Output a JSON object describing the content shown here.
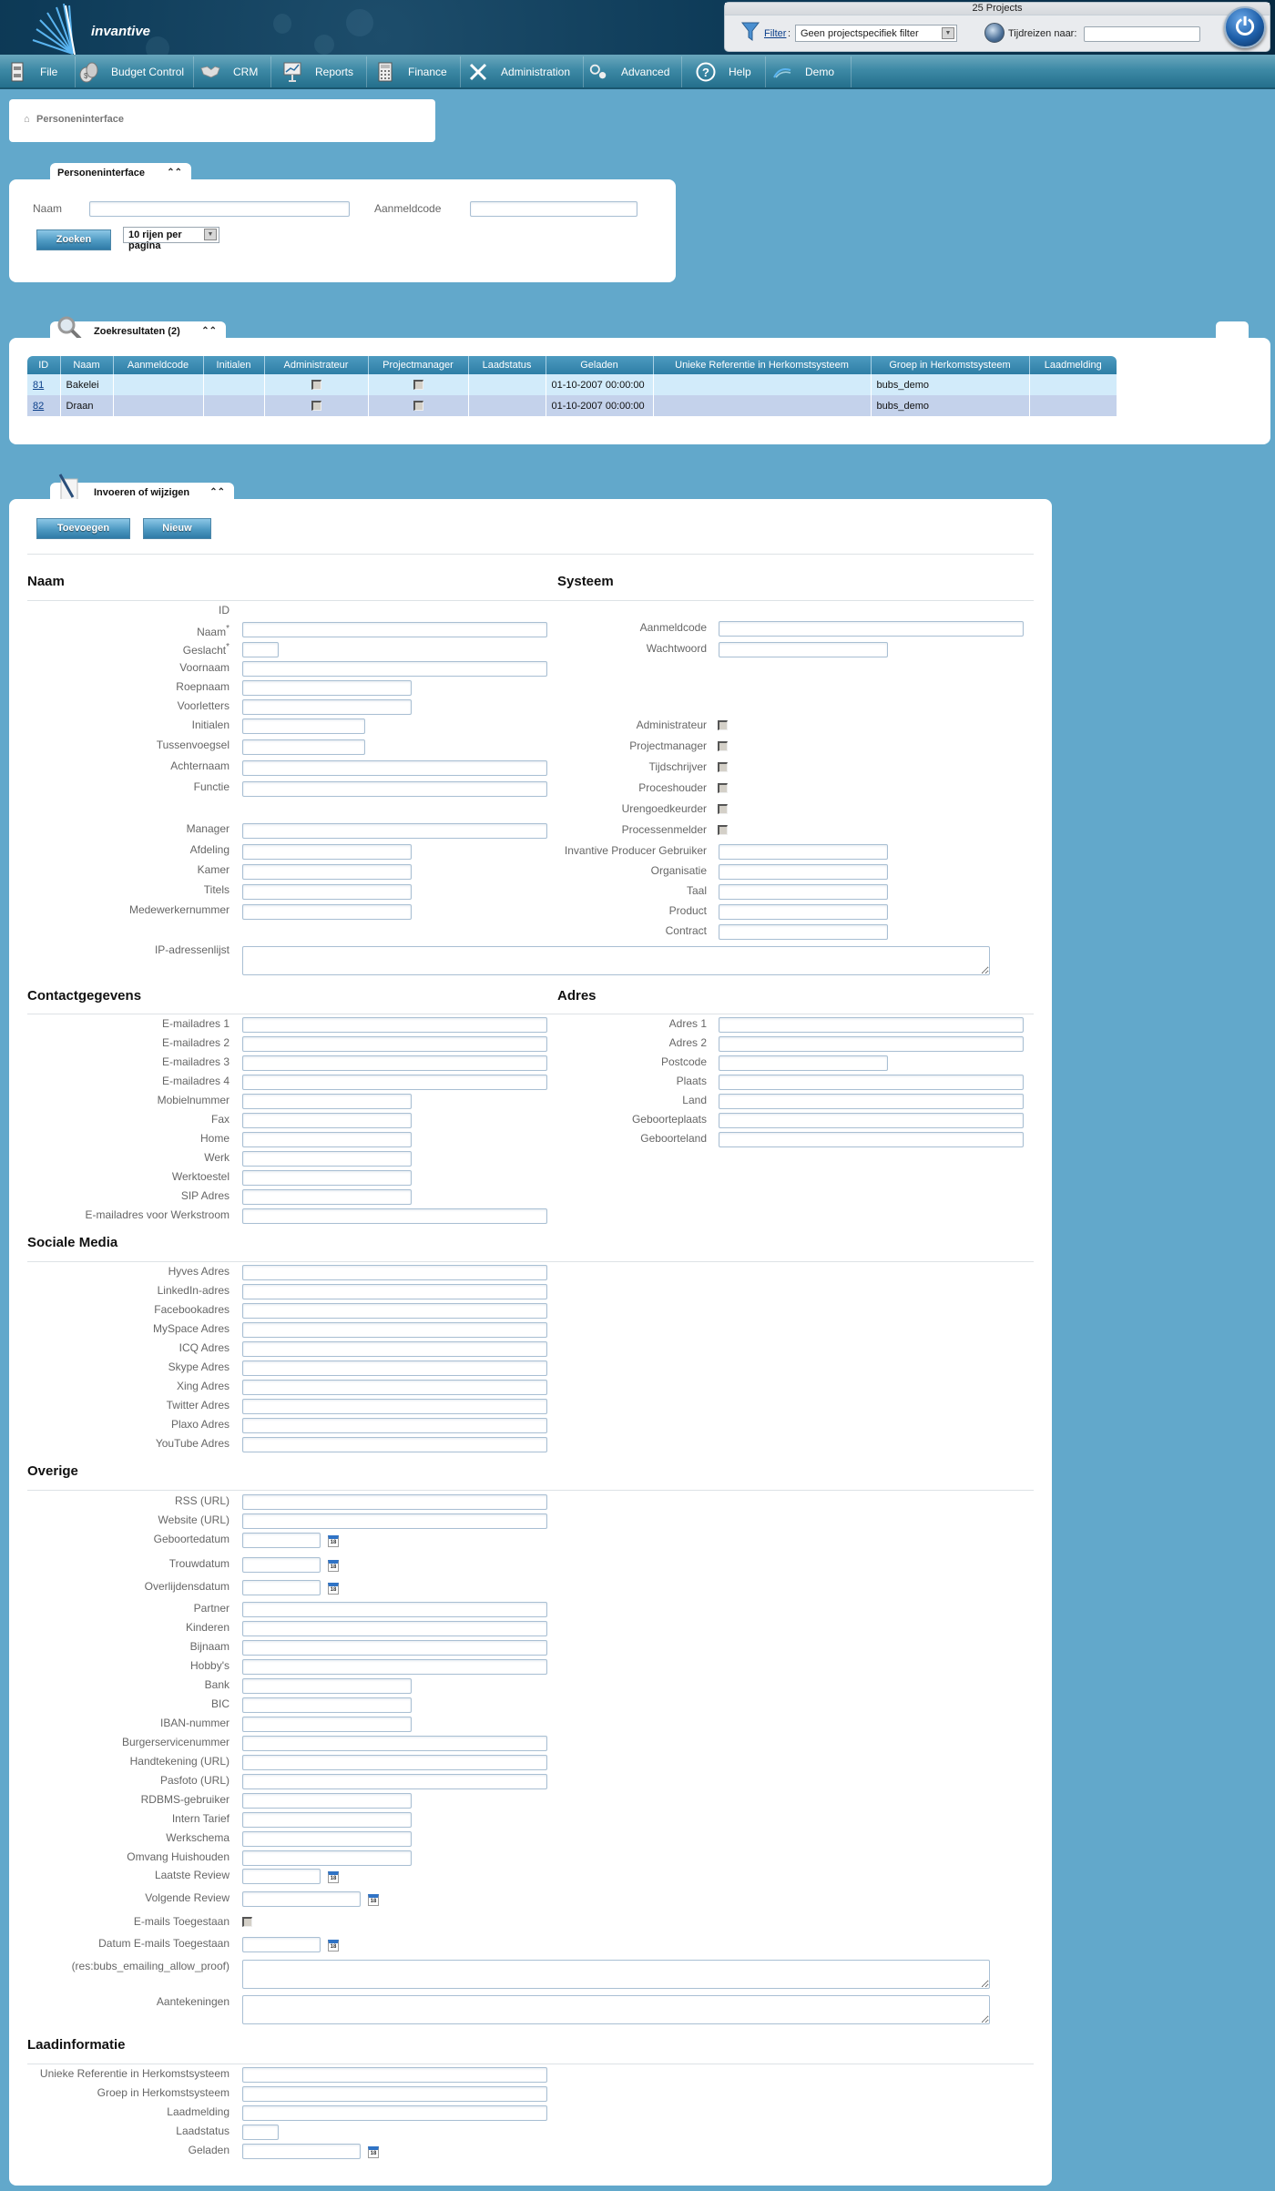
{
  "header": {
    "brand": "invantive",
    "projects_title": "25 Projects",
    "filter_link": "Filter",
    "filter_colon": ":",
    "filter_value": "Geen projectspecifiek filter",
    "time_travel_label": "Tijdreizen naar:",
    "time_travel_value": ""
  },
  "menu": [
    {
      "label": "File",
      "icon": "file-cabinet-icon"
    },
    {
      "label": "Budget Control",
      "icon": "money-bag-icon"
    },
    {
      "label": "CRM",
      "icon": "handshake-icon"
    },
    {
      "label": "Reports",
      "icon": "presentation-board-icon"
    },
    {
      "label": "Finance",
      "icon": "calculator-icon"
    },
    {
      "label": "Administration",
      "icon": "tools-icon"
    },
    {
      "label": "Advanced",
      "icon": "gears-icon"
    },
    {
      "label": "Help",
      "icon": "help-icon"
    },
    {
      "label": "Demo",
      "icon": "demo-logo-icon"
    }
  ],
  "breadcrumb": {
    "label": "Personeninterface"
  },
  "search_panel": {
    "tab_label": "Personeninterface",
    "naam_label": "Naam",
    "naam_value": "",
    "aanmeldcode_label": "Aanmeldcode",
    "aanmeldcode_value": "",
    "search_button": "Zoeken",
    "rows_select": "10 rijen per pagina"
  },
  "results_panel": {
    "tab_label": "Zoekresultaten (2)",
    "columns": [
      "ID",
      "Naam",
      "Aanmeldcode",
      "Initialen",
      "Administrateur",
      "Projectmanager",
      "Laadstatus",
      "Geladen",
      "Unieke Referentie in Herkomstsysteem",
      "Groep in Herkomstsysteem",
      "Laadmelding"
    ],
    "rows": [
      {
        "id": "81",
        "naam": "Bakelei",
        "aanmeldcode": "",
        "initialen": "",
        "administrateur": false,
        "projectmanager": false,
        "laadstatus": "",
        "geladen": "01-10-2007 00:00:00",
        "unieke_referentie": "",
        "groep": "bubs_demo",
        "laadmelding": ""
      },
      {
        "id": "82",
        "naam": "Draan",
        "aanmeldcode": "",
        "initialen": "",
        "administrateur": false,
        "projectmanager": false,
        "laadstatus": "",
        "geladen": "01-10-2007 00:00:00",
        "unieke_referentie": "",
        "groep": "bubs_demo",
        "laadmelding": ""
      }
    ]
  },
  "edit_panel": {
    "tab_label": "Invoeren of wijzigen",
    "add_button": "Toevoegen",
    "new_button": "Nieuw",
    "sections": {
      "naam": "Naam",
      "systeem": "Systeem",
      "contact": "Contactgegevens",
      "adres": "Adres",
      "sociale_media": "Sociale Media",
      "overige": "Overige",
      "laadinformatie": "Laadinformatie"
    },
    "naam_fields": {
      "id": "ID",
      "naam": "Naam",
      "geslacht": "Geslacht",
      "required_mark": "*",
      "voornaam": "Voornaam",
      "roepnaam": "Roepnaam",
      "voorletters": "Voorletters",
      "initialen": "Initialen",
      "tussenvoegsel": "Tussenvoegsel",
      "achternaam": "Achternaam",
      "functie": "Functie",
      "manager": "Manager",
      "afdeling": "Afdeling",
      "kamer": "Kamer",
      "titels": "Titels",
      "medewerkernummer": "Medewerkernummer",
      "ip_adressenlijst": "IP-adressenlijst"
    },
    "systeem_fields": {
      "aanmeldcode": "Aanmeldcode",
      "wachtwoord": "Wachtwoord",
      "administrateur": "Administrateur",
      "projectmanager": "Projectmanager",
      "tijdschrijver": "Tijdschrijver",
      "proceshouder": "Proceshouder",
      "urengoedkeurder": "Urengoedkeurder",
      "processenmelder": "Processenmelder",
      "producer_gebruiker": "Invantive Producer Gebruiker",
      "organisatie": "Organisatie",
      "taal": "Taal",
      "product": "Product",
      "contract": "Contract"
    },
    "systeem_checks": {
      "administrateur": false,
      "projectmanager": false,
      "tijdschrijver": false,
      "proceshouder": false,
      "urengoedkeurder": false,
      "processenmelder": false
    },
    "contact_fields": [
      "E-mailadres 1",
      "E-mailadres 2",
      "E-mailadres 3",
      "E-mailadres 4",
      "Mobielnummer",
      "Fax",
      "Home",
      "Werk",
      "Werktoestel",
      "SIP Adres",
      "E-mailadres voor Werkstroom"
    ],
    "adres_fields": [
      "Adres 1",
      "Adres 2",
      "Postcode",
      "Plaats",
      "Land",
      "Geboorteplaats",
      "Geboorteland"
    ],
    "social_fields": [
      "Hyves Adres",
      "LinkedIn-adres",
      "Facebookadres",
      "MySpace Adres",
      "ICQ Adres",
      "Skype Adres",
      "Xing Adres",
      "Twitter Adres",
      "Plaxo Adres",
      "YouTube Adres"
    ],
    "overige_fields": {
      "rss": "RSS (URL)",
      "website": "Website (URL)",
      "geboortedatum": "Geboortedatum",
      "trouwdatum": "Trouwdatum",
      "overlijdensdatum": "Overlijdensdatum",
      "partner": "Partner",
      "kinderen": "Kinderen",
      "bijnaam": "Bijnaam",
      "hobbys": "Hobby's",
      "bank": "Bank",
      "bic": "BIC",
      "iban": "IBAN-nummer",
      "bsn": "Burgerservicenummer",
      "handtekening": "Handtekening (URL)",
      "pasfoto": "Pasfoto (URL)",
      "rdbms": "RDBMS-gebruiker",
      "intern_tarief": "Intern Tarief",
      "werkschema": "Werkschema",
      "omvang": "Omvang Huishouden",
      "laatste_review": "Laatste Review",
      "volgende_review": "Volgende Review",
      "emails_toegestaan": "E-mails Toegestaan",
      "datum_emails": "Datum E-mails Toegestaan",
      "allow_proof": "(res:bubs_emailing_allow_proof)",
      "aantekeningen": "Aantekeningen"
    },
    "emails_toegestaan_checked": false,
    "laad_fields": {
      "unieke_referentie": "Unieke Referentie in Herkomstsysteem",
      "groep": "Groep in Herkomstsysteem",
      "laadmelding": "Laadmelding",
      "laadstatus": "Laadstatus",
      "geladen": "Geladen"
    },
    "calendar_glyph": "18"
  }
}
